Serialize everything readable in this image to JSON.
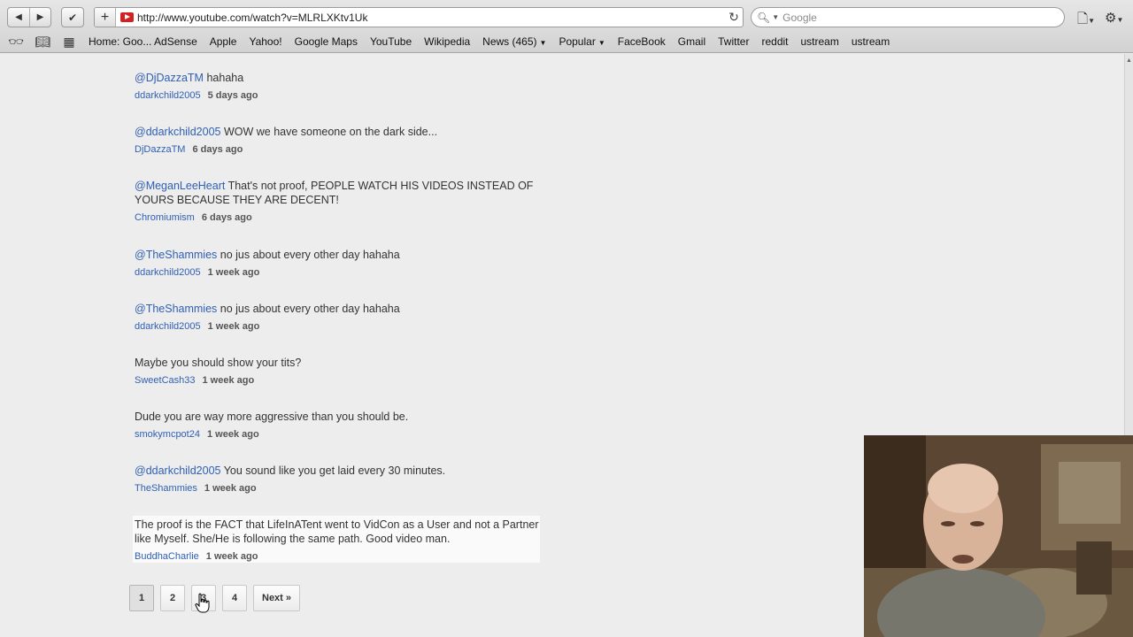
{
  "browser": {
    "url": "http://www.youtube.com/watch?v=MLRLXKtv1Uk",
    "search_placeholder": "Google",
    "bookmarks": [
      {
        "label": "Home: Goo... AdSense",
        "dropdown": false
      },
      {
        "label": "Apple",
        "dropdown": false
      },
      {
        "label": "Yahoo!",
        "dropdown": false
      },
      {
        "label": "Google Maps",
        "dropdown": false
      },
      {
        "label": "YouTube",
        "dropdown": false
      },
      {
        "label": "Wikipedia",
        "dropdown": false
      },
      {
        "label": "News (465)",
        "dropdown": true
      },
      {
        "label": "Popular",
        "dropdown": true
      },
      {
        "label": "FaceBook",
        "dropdown": false
      },
      {
        "label": "Gmail",
        "dropdown": false
      },
      {
        "label": "Twitter",
        "dropdown": false
      },
      {
        "label": "reddit",
        "dropdown": false
      },
      {
        "label": "ustream",
        "dropdown": false
      },
      {
        "label": "ustream",
        "dropdown": false
      }
    ]
  },
  "comments": [
    {
      "mention": "@DjDazzaTM",
      "text": " hahaha",
      "user": "ddarkchild2005",
      "time": "5 days ago"
    },
    {
      "mention": "@ddarkchild2005",
      "text": " WOW we have someone on the dark side...",
      "user": "DjDazzaTM",
      "time": "6 days ago"
    },
    {
      "mention": "@MeganLeeHeart",
      "text": " That's not proof, PEOPLE WATCH HIS VIDEOS INSTEAD OF YOURS BECAUSE THEY ARE DECENT!",
      "user": "Chromiumism",
      "time": "6 days ago"
    },
    {
      "mention": "@TheShammies",
      "text": " no jus about every other day hahaha",
      "user": "ddarkchild2005",
      "time": "1 week ago"
    },
    {
      "mention": "@TheShammies",
      "text": " no jus about every other day hahaha",
      "user": "ddarkchild2005",
      "time": "1 week ago"
    },
    {
      "mention": "",
      "text": "Maybe you should show your tits?",
      "user": "SweetCash33",
      "time": "1 week ago"
    },
    {
      "mention": "",
      "text": "Dude you are way more aggressive than you should be.",
      "user": "smokymcpot24",
      "time": "1 week ago"
    },
    {
      "mention": "@ddarkchild2005",
      "text": " You sound like you get laid every 30 minutes.",
      "user": "TheShammies",
      "time": "1 week ago"
    },
    {
      "mention": "",
      "text": "The proof is the FACT that LifeInATent went to VidCon as a User and not a Partner like Myself. She/He is following the same path. Good video man.",
      "user": "BuddhaCharlie",
      "time": "1 week ago"
    }
  ],
  "pagination": {
    "pages": [
      "1",
      "2",
      "3",
      "4"
    ],
    "current": "1",
    "next_label": "Next »"
  }
}
